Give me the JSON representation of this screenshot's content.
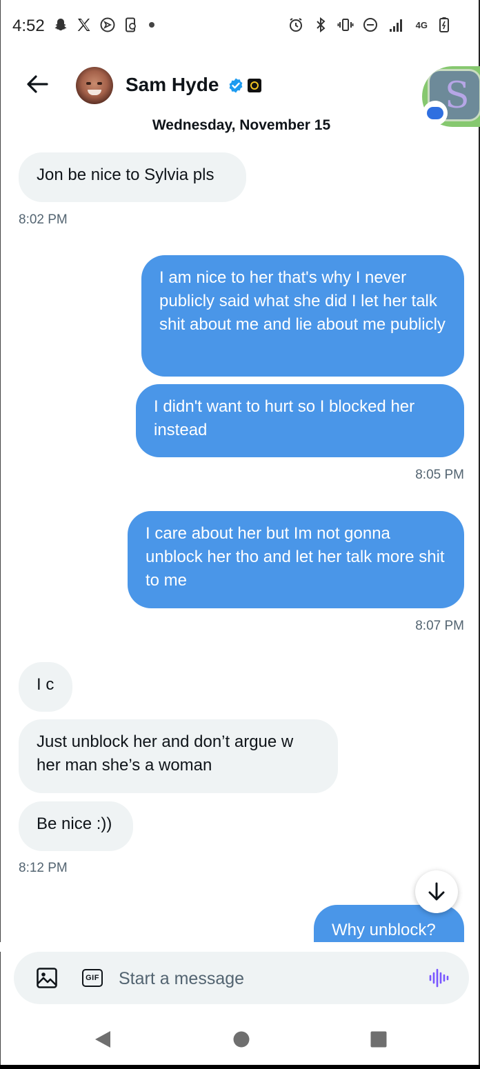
{
  "status_bar": {
    "time": "4:52",
    "left_icons": [
      "snapchat-icon",
      "x-logo-icon",
      "navigation-icon",
      "phone-sync-icon"
    ],
    "right_icons": [
      "alarm-icon",
      "bluetooth-icon",
      "vibrate-icon",
      "do-not-disturb-icon",
      "signal-icon",
      "battery-icon"
    ],
    "network": "4G"
  },
  "header": {
    "contact_name": "Sam Hyde",
    "date": "Wednesday, November 15",
    "verified": true
  },
  "messages": [
    {
      "direction": "in",
      "text": "Jon be nice to Sylvia pls"
    },
    {
      "direction": "in_time",
      "text": "8:02 PM"
    },
    {
      "direction": "out",
      "text": "I am nice to her that's why I never publicly said what she did I let her talk shit about me and lie about me publicly"
    },
    {
      "direction": "out",
      "text": "I didn't want to hurt so I blocked her instead"
    },
    {
      "direction": "out_time",
      "text": "8:05 PM"
    },
    {
      "direction": "out",
      "text": "I care about her but Im not gonna unblock her tho and let her talk more shit to me"
    },
    {
      "direction": "out_time",
      "text": "8:07 PM"
    },
    {
      "direction": "in",
      "text": "I c"
    },
    {
      "direction": "in",
      "text": "Just unblock her and don’t argue w her man she’s a woman"
    },
    {
      "direction": "in",
      "text": "Be nice :))"
    },
    {
      "direction": "in_time",
      "text": "8:12 PM"
    },
    {
      "direction": "out",
      "text": "Why unblock?"
    }
  ],
  "composer": {
    "placeholder": "Start a message",
    "icons": [
      "image-icon",
      "gif-icon",
      "voice-icon"
    ]
  },
  "colors": {
    "outgoing_bubble": "#4a96e8",
    "incoming_bubble": "#eff3f4",
    "accent": "#1d9bf0",
    "voice_icon": "#7856ff"
  }
}
